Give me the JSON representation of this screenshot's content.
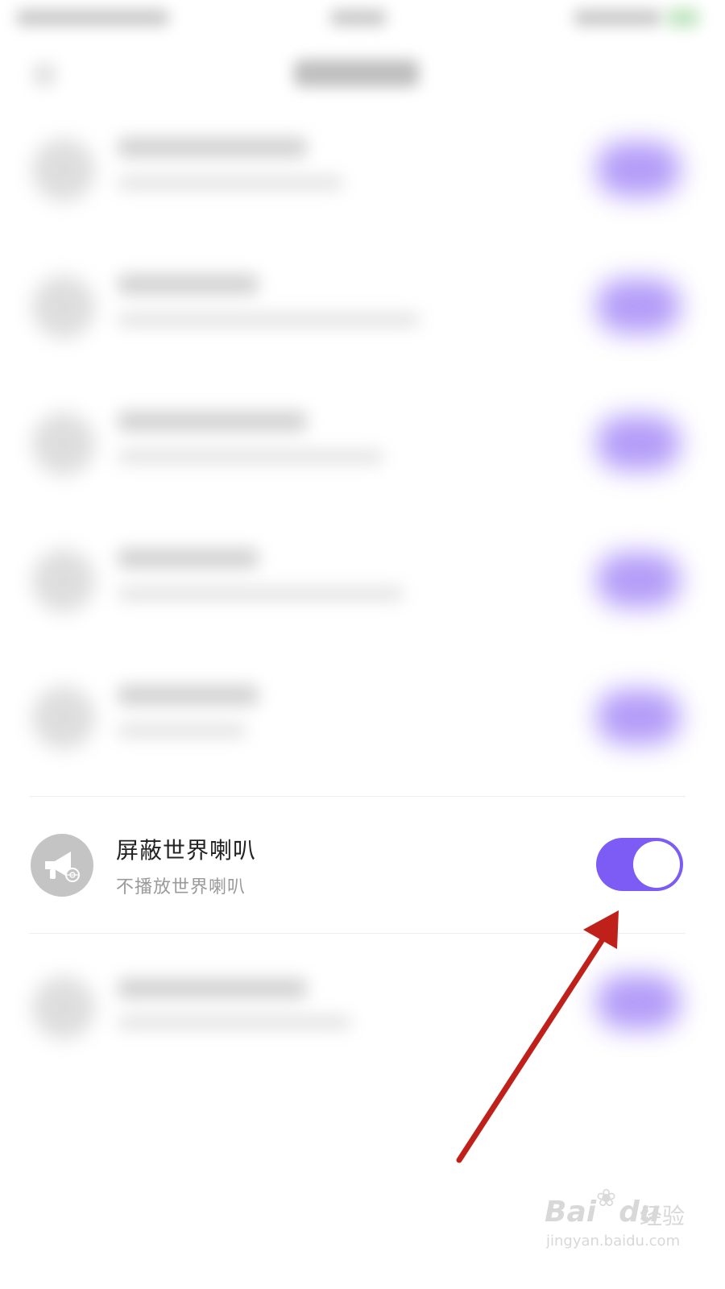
{
  "setting": {
    "title": "屏蔽世界喇叭",
    "subtitle": "不播放世界喇叭",
    "icon": "megaphone-icon",
    "toggle_on": true
  },
  "watermark": {
    "logo": "Bai",
    "logo_tail": "du",
    "product": "经验",
    "url": "jingyan.baidu.com"
  },
  "colors": {
    "accent": "#7c5cf5",
    "annotation_arrow": "#c0201a"
  }
}
